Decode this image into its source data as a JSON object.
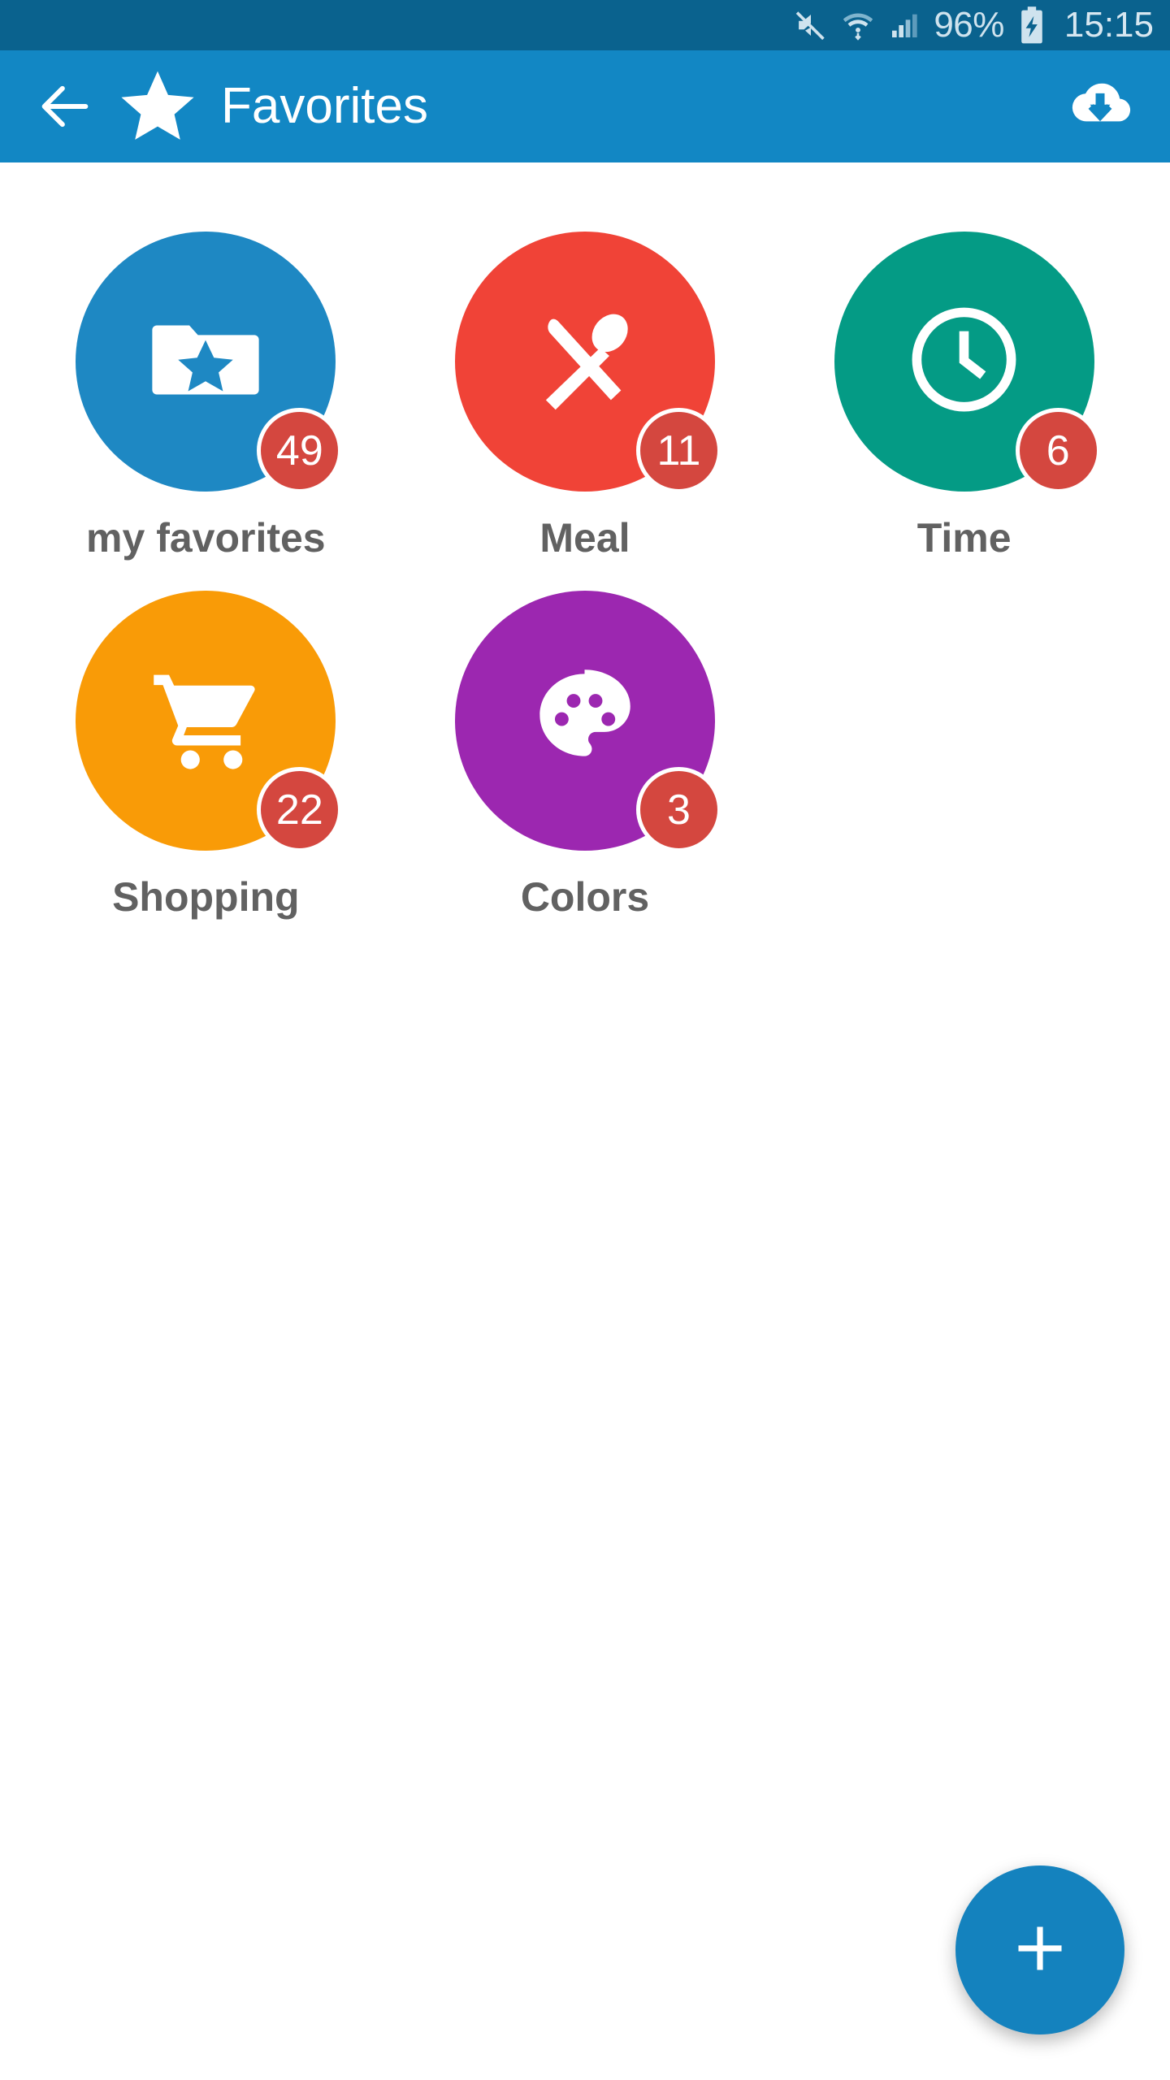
{
  "status_bar": {
    "background": "#0A628E",
    "mute_icon": "mute-icon",
    "wifi_icon": "wifi-icon",
    "signal_icon": "signal-icon",
    "battery_percent": "96%",
    "battery_icon": "battery-charging-icon",
    "time": "15:15"
  },
  "app_bar": {
    "background": "#1287C4",
    "back_icon": "back-arrow-icon",
    "star_icon": "star-icon",
    "title": "Favorites",
    "action_icon": "cloud-download-icon"
  },
  "grid": {
    "tiles": [
      {
        "label": "my favorites",
        "badge": "49",
        "color": "#1E88C3",
        "icon": "folder-star-icon"
      },
      {
        "label": "Meal",
        "badge": "11",
        "color": "#F04337",
        "icon": "cutlery-icon"
      },
      {
        "label": "Time",
        "badge": "6",
        "color": "#049B85",
        "icon": "clock-icon"
      },
      {
        "label": "Shopping",
        "badge": "22",
        "color": "#F99B07",
        "icon": "shopping-cart-icon"
      },
      {
        "label": "Colors",
        "badge": "3",
        "color": "#9C27B0",
        "icon": "palette-icon"
      }
    ],
    "badge_color": "#D4473F",
    "label_color": "#616161"
  },
  "fab": {
    "icon": "plus-icon",
    "color": "#1482BE"
  }
}
